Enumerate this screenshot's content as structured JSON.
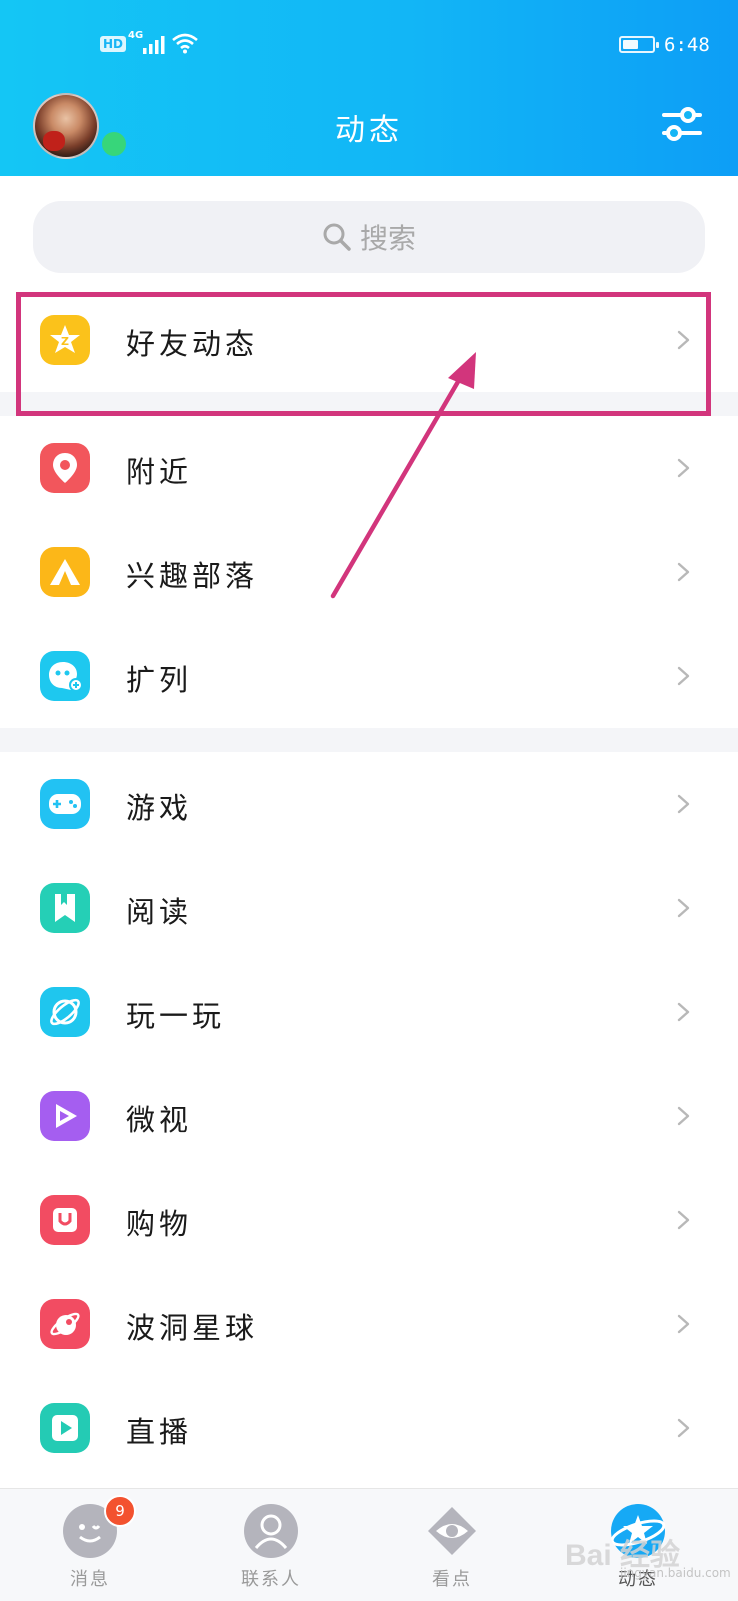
{
  "status_bar": {
    "hd": "HD",
    "network": "4G",
    "time": "6:48",
    "battery_level": 0.55
  },
  "header": {
    "title": "动态",
    "settings_icon": "sliders-icon",
    "avatar_online": true
  },
  "search": {
    "placeholder": "搜索",
    "icon": "search-icon"
  },
  "sections": [
    [
      {
        "label": "好友动态",
        "icon": "qzone-star-icon",
        "color": "#fbc21b",
        "highlighted": true
      }
    ],
    [
      {
        "label": "附近",
        "icon": "location-pin-icon",
        "color": "#f2565c"
      },
      {
        "label": "兴趣部落",
        "icon": "tent-icon",
        "color": "#fcb718"
      },
      {
        "label": "扩列",
        "icon": "chat-face-plus-icon",
        "color": "#1ec8ef"
      }
    ],
    [
      {
        "label": "游戏",
        "icon": "gamepad-icon",
        "color": "#22c2f3"
      },
      {
        "label": "阅读",
        "icon": "bookmark-icon",
        "color": "#25cfb6"
      },
      {
        "label": "玩一玩",
        "icon": "planet-icon",
        "color": "#1fc6ee"
      },
      {
        "label": "微视",
        "icon": "play-icon",
        "color": "#a55ef0"
      },
      {
        "label": "购物",
        "icon": "shopping-bag-icon",
        "color": "#f24c62"
      },
      {
        "label": "波洞星球",
        "icon": "comet-icon",
        "color": "#f24c62"
      },
      {
        "label": "直播",
        "icon": "live-play-icon",
        "color": "#24cbb4"
      }
    ]
  ],
  "tabbar": {
    "tabs": [
      {
        "label": "消息",
        "icon": "chat-bubble-icon",
        "badge": "9"
      },
      {
        "label": "联系人",
        "icon": "contact-person-icon"
      },
      {
        "label": "看点",
        "icon": "eye-icon"
      },
      {
        "label": "动态",
        "icon": "star-planet-icon",
        "active": true
      }
    ]
  },
  "watermark": {
    "text": "Bai 经验",
    "sub": "jingyan.baidu.com"
  }
}
